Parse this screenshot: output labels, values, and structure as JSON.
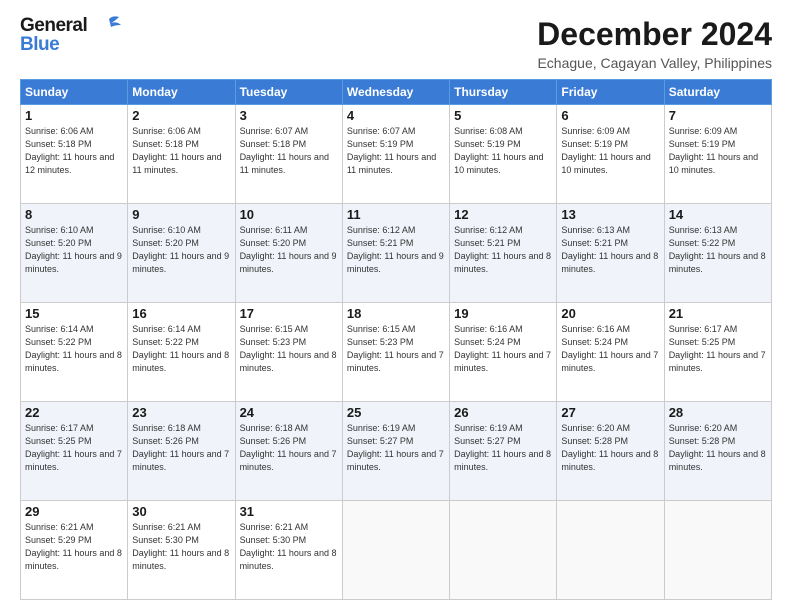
{
  "header": {
    "logo_general": "General",
    "logo_blue": "Blue",
    "month_title": "December 2024",
    "location": "Echague, Cagayan Valley, Philippines"
  },
  "days_of_week": [
    "Sunday",
    "Monday",
    "Tuesday",
    "Wednesday",
    "Thursday",
    "Friday",
    "Saturday"
  ],
  "weeks": [
    [
      {
        "day": "1",
        "sunrise": "6:06 AM",
        "sunset": "5:18 PM",
        "daylight": "11 hours and 12 minutes."
      },
      {
        "day": "2",
        "sunrise": "6:06 AM",
        "sunset": "5:18 PM",
        "daylight": "11 hours and 11 minutes."
      },
      {
        "day": "3",
        "sunrise": "6:07 AM",
        "sunset": "5:18 PM",
        "daylight": "11 hours and 11 minutes."
      },
      {
        "day": "4",
        "sunrise": "6:07 AM",
        "sunset": "5:19 PM",
        "daylight": "11 hours and 11 minutes."
      },
      {
        "day": "5",
        "sunrise": "6:08 AM",
        "sunset": "5:19 PM",
        "daylight": "11 hours and 10 minutes."
      },
      {
        "day": "6",
        "sunrise": "6:09 AM",
        "sunset": "5:19 PM",
        "daylight": "11 hours and 10 minutes."
      },
      {
        "day": "7",
        "sunrise": "6:09 AM",
        "sunset": "5:19 PM",
        "daylight": "11 hours and 10 minutes."
      }
    ],
    [
      {
        "day": "8",
        "sunrise": "6:10 AM",
        "sunset": "5:20 PM",
        "daylight": "11 hours and 9 minutes."
      },
      {
        "day": "9",
        "sunrise": "6:10 AM",
        "sunset": "5:20 PM",
        "daylight": "11 hours and 9 minutes."
      },
      {
        "day": "10",
        "sunrise": "6:11 AM",
        "sunset": "5:20 PM",
        "daylight": "11 hours and 9 minutes."
      },
      {
        "day": "11",
        "sunrise": "6:12 AM",
        "sunset": "5:21 PM",
        "daylight": "11 hours and 9 minutes."
      },
      {
        "day": "12",
        "sunrise": "6:12 AM",
        "sunset": "5:21 PM",
        "daylight": "11 hours and 8 minutes."
      },
      {
        "day": "13",
        "sunrise": "6:13 AM",
        "sunset": "5:21 PM",
        "daylight": "11 hours and 8 minutes."
      },
      {
        "day": "14",
        "sunrise": "6:13 AM",
        "sunset": "5:22 PM",
        "daylight": "11 hours and 8 minutes."
      }
    ],
    [
      {
        "day": "15",
        "sunrise": "6:14 AM",
        "sunset": "5:22 PM",
        "daylight": "11 hours and 8 minutes."
      },
      {
        "day": "16",
        "sunrise": "6:14 AM",
        "sunset": "5:22 PM",
        "daylight": "11 hours and 8 minutes."
      },
      {
        "day": "17",
        "sunrise": "6:15 AM",
        "sunset": "5:23 PM",
        "daylight": "11 hours and 8 minutes."
      },
      {
        "day": "18",
        "sunrise": "6:15 AM",
        "sunset": "5:23 PM",
        "daylight": "11 hours and 7 minutes."
      },
      {
        "day": "19",
        "sunrise": "6:16 AM",
        "sunset": "5:24 PM",
        "daylight": "11 hours and 7 minutes."
      },
      {
        "day": "20",
        "sunrise": "6:16 AM",
        "sunset": "5:24 PM",
        "daylight": "11 hours and 7 minutes."
      },
      {
        "day": "21",
        "sunrise": "6:17 AM",
        "sunset": "5:25 PM",
        "daylight": "11 hours and 7 minutes."
      }
    ],
    [
      {
        "day": "22",
        "sunrise": "6:17 AM",
        "sunset": "5:25 PM",
        "daylight": "11 hours and 7 minutes."
      },
      {
        "day": "23",
        "sunrise": "6:18 AM",
        "sunset": "5:26 PM",
        "daylight": "11 hours and 7 minutes."
      },
      {
        "day": "24",
        "sunrise": "6:18 AM",
        "sunset": "5:26 PM",
        "daylight": "11 hours and 7 minutes."
      },
      {
        "day": "25",
        "sunrise": "6:19 AM",
        "sunset": "5:27 PM",
        "daylight": "11 hours and 7 minutes."
      },
      {
        "day": "26",
        "sunrise": "6:19 AM",
        "sunset": "5:27 PM",
        "daylight": "11 hours and 8 minutes."
      },
      {
        "day": "27",
        "sunrise": "6:20 AM",
        "sunset": "5:28 PM",
        "daylight": "11 hours and 8 minutes."
      },
      {
        "day": "28",
        "sunrise": "6:20 AM",
        "sunset": "5:28 PM",
        "daylight": "11 hours and 8 minutes."
      }
    ],
    [
      {
        "day": "29",
        "sunrise": "6:21 AM",
        "sunset": "5:29 PM",
        "daylight": "11 hours and 8 minutes."
      },
      {
        "day": "30",
        "sunrise": "6:21 AM",
        "sunset": "5:30 PM",
        "daylight": "11 hours and 8 minutes."
      },
      {
        "day": "31",
        "sunrise": "6:21 AM",
        "sunset": "5:30 PM",
        "daylight": "11 hours and 8 minutes."
      },
      null,
      null,
      null,
      null
    ]
  ]
}
